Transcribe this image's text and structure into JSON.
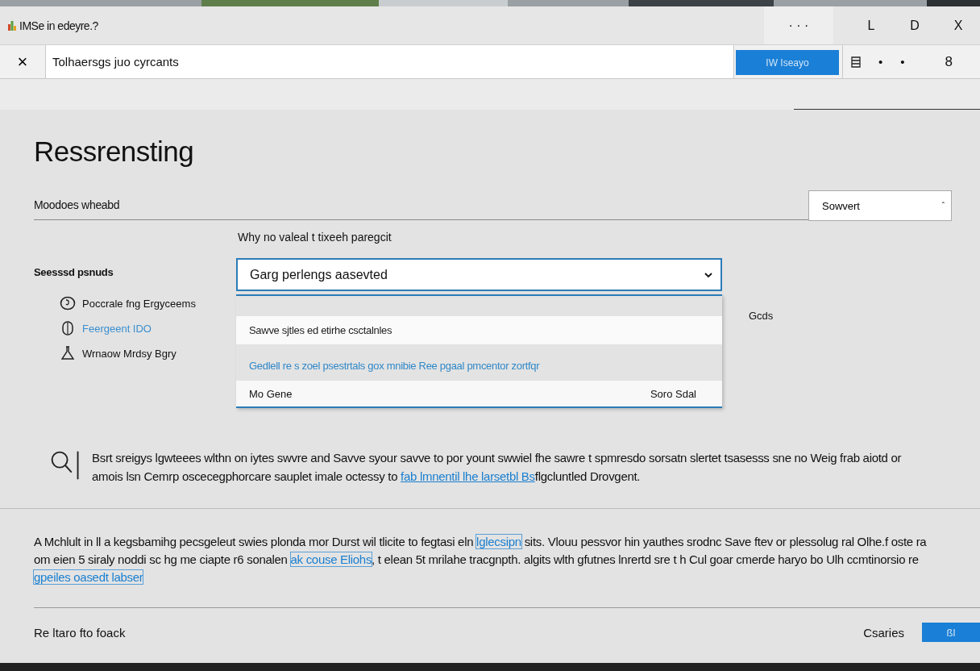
{
  "window": {
    "title": "IMSe in edeyre.?",
    "controls": [
      "· · ·",
      "L",
      "D",
      "X"
    ]
  },
  "toolbar": {
    "close": "×",
    "search": {
      "value": "Tolhaersgs juo cyrcants"
    },
    "button": "IW Iseayo",
    "extras": [
      "•",
      "•",
      "8"
    ]
  },
  "heading": "Ressrensting",
  "section": {
    "label": "Moodoes wheabd",
    "dropdown": {
      "value": "Sowvert",
      "caret": "ˆ"
    }
  },
  "field": {
    "label": "Why no valeal t tixeeh paregcit",
    "value": "Garg perlengs aasevted",
    "expanded": true,
    "options": [
      {
        "kind": "option",
        "label": "Sawve sjtles ed etirhe csctalnles",
        "selected": false
      },
      {
        "kind": "option",
        "label": "Gedlell re s zoel psestrtals gox mnibie Ree pgaal pmcentor zortfqr",
        "selected": true
      },
      {
        "kind": "footer",
        "label": "Mo Gene",
        "aside": "Soro Sdal",
        "selected": false
      }
    ]
  },
  "side_note": "Gcds",
  "sidebar": {
    "title": "Seesssd psnuds",
    "items": [
      {
        "label": "Poccrale fng Ergyceems",
        "kind": "text"
      },
      {
        "label": "Feergeent IDO",
        "kind": "link"
      },
      {
        "label": "Wrnaow Mrdsy Bgry",
        "kind": "text"
      }
    ]
  },
  "info": [
    {
      "kind": "text",
      "text": "Bsrt sreigys lgwteees wlthn on iytes swvre and Savve syour savve to por yount swwiel fhe sawre t spmresdo sorsatn slertet tsasesss sne no Weig frab aiotd or amois lsn Cemrp oscecegphorcare sauplet imale octessy to "
    },
    {
      "kind": "link",
      "text": "fab lmnentil lhe larsetbl Bs"
    },
    {
      "kind": "text",
      "text": "flgcluntled Drovgent."
    }
  ],
  "paragraph": [
    {
      "kind": "text",
      "text": "A Mchlult in ll a kegsbamihg pecsgeleut swies plonda mor Durst wil tlicite to fegtasi eln "
    },
    {
      "kind": "link",
      "text": "lglecsipn"
    },
    {
      "kind": "text",
      "text": " sits. Vlouu pessvor hin yauthes srodnc Save ftev or plessolug ral Olhe.f oste ra om eien 5 siraly noddi sc hg me ciapte r6 sonalen "
    },
    {
      "kind": "link",
      "text": "ak couse Eliohs"
    },
    {
      "kind": "text",
      "text": ", t elean 5t mrilahe tracgnpth. algits wlth gfutnes lnrertd sre t h Cul goar cmerde haryo bo Ulh ccmtinorsio re "
    },
    {
      "kind": "link",
      "text": "gpeiles oasedt labser"
    }
  ],
  "footer": {
    "label": "Re ltaro fto foack",
    "aside": "Csaries",
    "button": "ßl"
  }
}
